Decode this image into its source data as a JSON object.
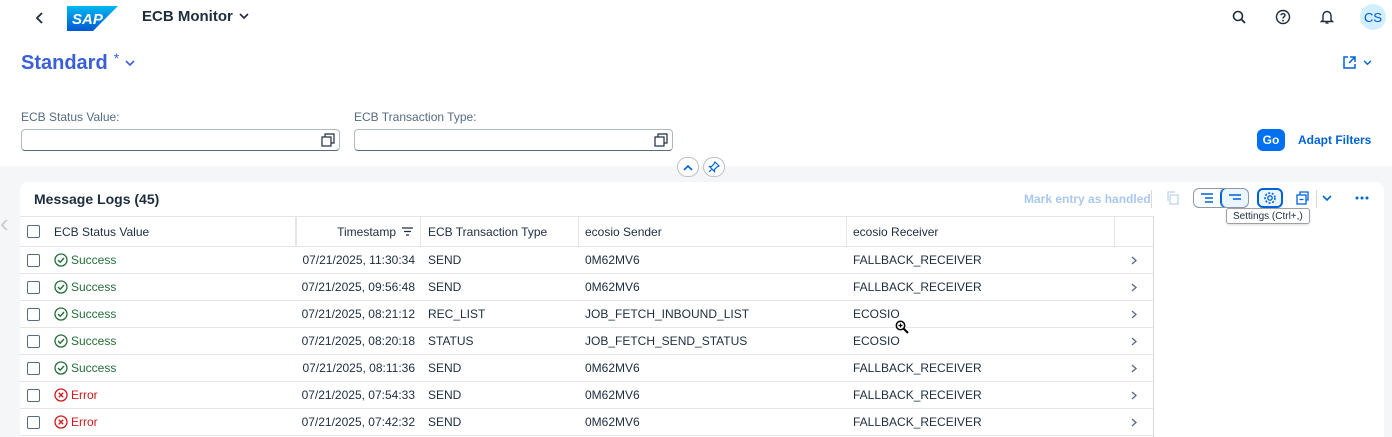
{
  "shell": {
    "app_title": "ECB Monitor",
    "logo_text": "SAP",
    "avatar_initials": "CS",
    "icons": [
      "back-icon",
      "search-icon",
      "help-icon",
      "notifications-icon"
    ]
  },
  "variant": {
    "title": "Standard",
    "modified_marker": "*"
  },
  "filters": {
    "status_label": "ECB Status Value:",
    "status_value": "",
    "type_label": "ECB Transaction Type:",
    "type_value": "",
    "go_label": "Go",
    "adapt_label": "Adapt Filters"
  },
  "table": {
    "title": "Message Logs (45)",
    "mark_handled_label": "Mark entry as handled",
    "tooltip": "Settings (Ctrl+,)",
    "columns": {
      "status": "ECB Status Value",
      "timestamp": "Timestamp",
      "type": "ECB Transaction Type",
      "sender": "ecosio Sender",
      "receiver": "ecosio Receiver"
    },
    "rows": [
      {
        "status": "Success",
        "kind": "ok",
        "timestamp": "07/21/2025, 11:30:34",
        "type": "SEND",
        "sender": "0M62MV6",
        "receiver": "FALLBACK_RECEIVER"
      },
      {
        "status": "Success",
        "kind": "ok",
        "timestamp": "07/21/2025, 09:56:48",
        "type": "SEND",
        "sender": "0M62MV6",
        "receiver": "FALLBACK_RECEIVER"
      },
      {
        "status": "Success",
        "kind": "ok",
        "timestamp": "07/21/2025, 08:21:12",
        "type": "REC_LIST",
        "sender": "JOB_FETCH_INBOUND_LIST",
        "receiver": "ECOSIO"
      },
      {
        "status": "Success",
        "kind": "ok",
        "timestamp": "07/21/2025, 08:20:18",
        "type": "STATUS",
        "sender": "JOB_FETCH_SEND_STATUS",
        "receiver": "ECOSIO"
      },
      {
        "status": "Success",
        "kind": "ok",
        "timestamp": "07/21/2025, 08:11:36",
        "type": "SEND",
        "sender": "0M62MV6",
        "receiver": "FALLBACK_RECEIVER"
      },
      {
        "status": "Error",
        "kind": "err",
        "timestamp": "07/21/2025, 07:54:33",
        "type": "SEND",
        "sender": "0M62MV6",
        "receiver": "FALLBACK_RECEIVER"
      },
      {
        "status": "Error",
        "kind": "err",
        "timestamp": "07/21/2025, 07:42:32",
        "type": "SEND",
        "sender": "0M62MV6",
        "receiver": "FALLBACK_RECEIVER"
      }
    ]
  },
  "colors": {
    "brand_blue": "#0064d9",
    "success": "#256f3a",
    "error": "#d0191c",
    "title_blue": "#3a5fd9"
  }
}
